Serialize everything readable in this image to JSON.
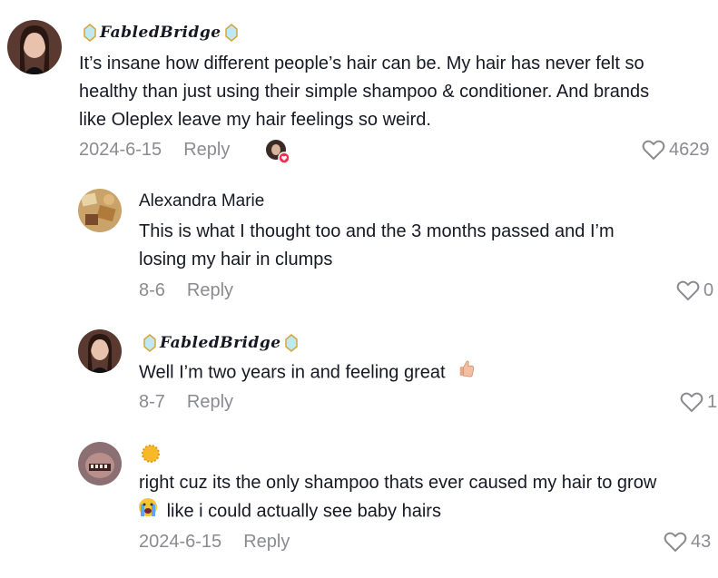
{
  "comments": [
    {
      "username": "FabledBridge",
      "text_lines": [
        "It’s insane how different people’s hair can be. My hair has never felt so",
        "healthy than just using their simple shampoo & conditioner. And brands",
        "like Oleplex leave my hair feelings so weird."
      ],
      "date": "2024-6-15",
      "reply_label": "Reply",
      "likes": "4629"
    },
    {
      "username": "Alexandra Marie",
      "text_lines": [
        "This is what I thought too and the 3 months passed and I’m",
        "losing my hair in clumps"
      ],
      "date": "8-6",
      "reply_label": "Reply",
      "likes": "0"
    },
    {
      "username": "FabledBridge",
      "text_lines": [
        "Well I’m two years in and feeling great"
      ],
      "date": "8-7",
      "reply_label": "Reply",
      "likes": "1"
    },
    {
      "username": "",
      "text_lines": [
        "right cuz its the only shampoo thats ever caused my hair to grow",
        "like i could actually see baby hairs"
      ],
      "date": "2024-6-15",
      "reply_label": "Reply",
      "likes": "43"
    }
  ],
  "icons": {
    "heart": "heart-icon",
    "gem": "gem-icon",
    "thumbs_up": "thumbs-up-emoji",
    "sun": "sun-emoji",
    "crying": "crying-emoji",
    "creator_liked": "creator-liked-badge"
  },
  "colors": {
    "text": "#161823",
    "meta": "#8a8b91",
    "like_badge": "#fe2c55"
  }
}
